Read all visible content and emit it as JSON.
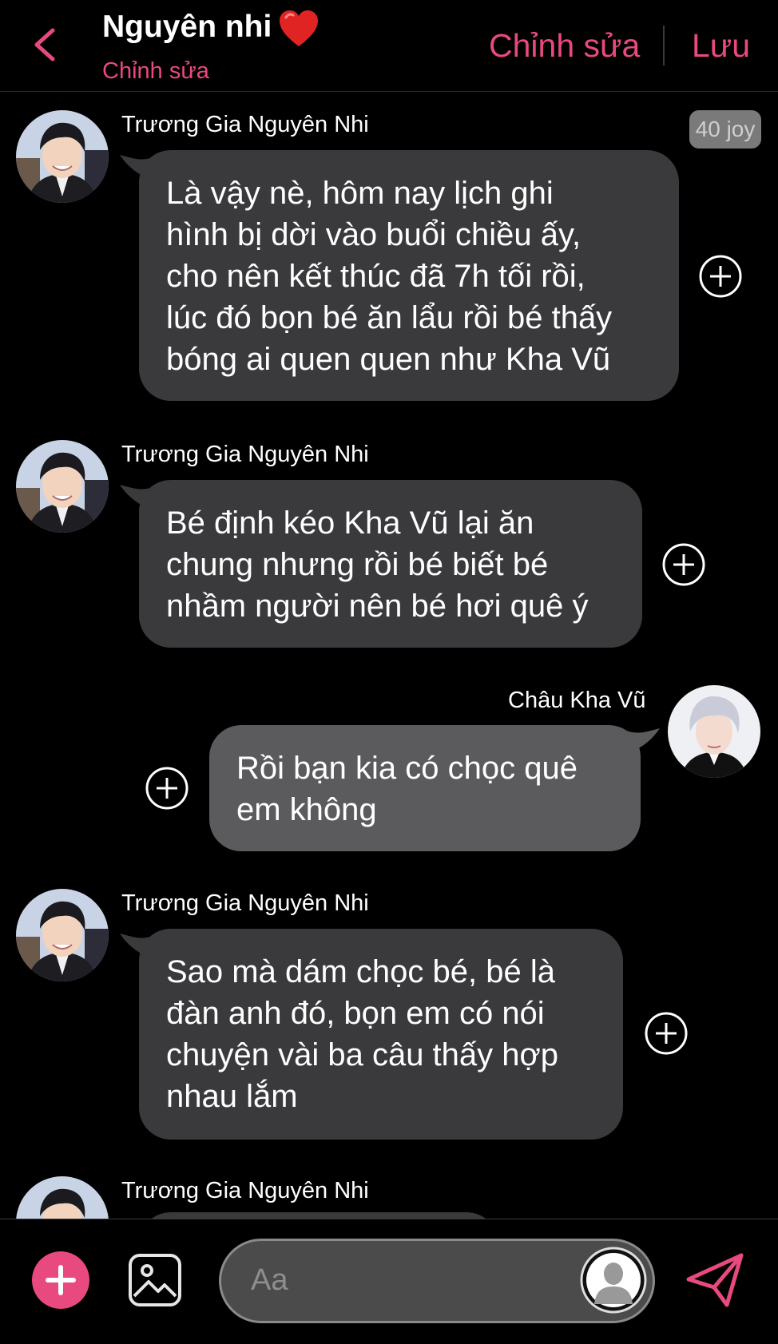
{
  "header": {
    "title": "Nguyên nhi",
    "subtitle": "Chỉnh sửa",
    "edit_label": "Chỉnh sửa",
    "save_label": "Lưu"
  },
  "badge": {
    "joy": "40 joy"
  },
  "messages": [
    {
      "sender": "Trương Gia Nguyên Nhi",
      "lines": [
        "Là vậy nè, hôm nay lịch ghi",
        "hình bị dời vào buổi chiều ấy,",
        "cho nên kết thúc đã 7h tối rồi,",
        "lúc đó bọn bé ăn lẩu rồi bé thấy",
        "bóng ai quen quen như Kha Vũ"
      ]
    },
    {
      "sender": "Trương Gia Nguyên Nhi",
      "lines": [
        "Bé định kéo Kha Vũ lại ăn",
        "chung nhưng rồi bé biết bé",
        "nhầm người nên bé hơi quê ý"
      ]
    },
    {
      "sender": "Châu Kha Vũ",
      "lines": [
        "Rồi bạn kia có chọc quê",
        "em không"
      ]
    },
    {
      "sender": "Trương Gia Nguyên Nhi",
      "lines": [
        "Sao mà dám chọc bé, bé là",
        "đàn anh đó, bọn em có nói",
        "chuyện vài ba câu thấy hợp",
        "nhau lắm"
      ]
    },
    {
      "sender": "Trương Gia Nguyên Nhi",
      "lines": []
    }
  ],
  "composer": {
    "placeholder": "Aa"
  },
  "colors": {
    "accent": "#e8497f",
    "bubble": "#3a3a3c",
    "background": "#000000"
  },
  "icons": {
    "back": "chevron-left-icon",
    "heart": "heart-icon",
    "plus": "plus-circle-icon",
    "add": "plus-icon",
    "image": "image-icon",
    "send": "send-icon",
    "user": "user-silhouette-icon"
  }
}
